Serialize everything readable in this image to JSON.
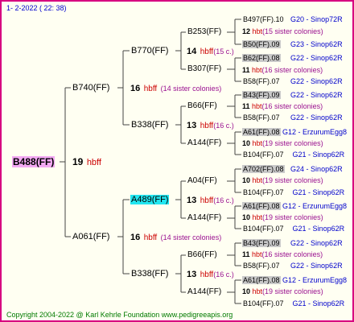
{
  "header": {
    "text": "1-  2-2022 ( 22: 38)"
  },
  "root": {
    "name": "B488(FF)",
    "num": "19",
    "hb": "hbff"
  },
  "gen1": [
    {
      "name": "B740(FF)",
      "num": "16",
      "hb": "hbff",
      "sis": "(14 sister colonies)"
    },
    {
      "name": "A061(FF)",
      "num": "16",
      "hb": "hbff",
      "sis": "(14 sister colonies)"
    }
  ],
  "gen2": [
    {
      "name": "B770(FF)",
      "num": "14",
      "hb": "hbff",
      "sis": "(15 c.)"
    },
    {
      "name": "B338(FF)",
      "num": "13",
      "hb": "hbff",
      "sis": "(16 c.)"
    },
    {
      "name": "A489(FF)",
      "num": "13",
      "hb": "hbff",
      "sis": "(16 c.)"
    },
    {
      "name": "B338(FF)",
      "num": "13",
      "hb": "hbff",
      "sis": "(16 c.)"
    }
  ],
  "gen3": [
    {
      "name": "B253(FF)",
      "num": "14",
      "hb": "hbff",
      "sis": "(15 c.)"
    },
    {
      "name": "B307(FF)"
    },
    {
      "name": "B66(FF)",
      "num": "13",
      "hb": "hbff",
      "sis": "(16 c.)"
    },
    {
      "name": "A144(FF)"
    },
    {
      "name": "A04(FF)",
      "num": "13",
      "hb": "hbff",
      "sis": "(16 c.)"
    },
    {
      "name": "A144(FF)"
    },
    {
      "name": "B66(FF)",
      "num": "13",
      "hb": "hbff",
      "sis": "(16 c.)"
    },
    {
      "name": "A144(FF)"
    }
  ],
  "gen4": [
    {
      "name": "B497(FF).10",
      "cls": "G20 - Sinop72R",
      "num": "12",
      "hb": "hbt",
      "sis": "(15 sister colonies)"
    },
    {
      "name": "B50(FF).09",
      "cls": "G23 - Sinop62R",
      "num": "",
      "hb": "",
      "sis": ""
    },
    {
      "name": "B62(FF).08",
      "cls": "G22 - Sinop62R",
      "num": "11",
      "hb": "hbt",
      "sis": "(16 sister colonies)"
    },
    {
      "name": "B58(FF).07",
      "cls": "G22 - Sinop62R",
      "num": "",
      "hb": "",
      "sis": ""
    },
    {
      "name": "B43(FF).09",
      "cls": "G22 - Sinop62R",
      "num": "11",
      "hb": "hbt",
      "sis": "(16 sister colonies)"
    },
    {
      "name": "B58(FF).07",
      "cls": "G22 - Sinop62R",
      "num": "",
      "hb": "",
      "sis": ""
    },
    {
      "name": "A61(FF).08",
      "cls": "G12 - ErzurumEgg8",
      "num": "10",
      "hb": "hbt",
      "sis": "(19 sister colonies)"
    },
    {
      "name": "B104(FF).07",
      "cls": "G21 - Sinop62R",
      "num": "",
      "hb": "",
      "sis": ""
    },
    {
      "name": "A702(FF).08",
      "cls": "G24 - Sinop62R",
      "num": "10",
      "hb": "hbt",
      "sis": "(19 sister colonies)"
    },
    {
      "name": "B104(FF).07",
      "cls": "G21 - Sinop62R",
      "num": "",
      "hb": "",
      "sis": ""
    },
    {
      "name": "A61(FF).08",
      "cls": "G12 - ErzurumEgg8",
      "num": "10",
      "hb": "hbt",
      "sis": "(19 sister colonies)"
    },
    {
      "name": "B104(FF).07",
      "cls": "G21 - Sinop62R",
      "num": "",
      "hb": "",
      "sis": ""
    },
    {
      "name": "B43(FF).09",
      "cls": "G22 - Sinop62R",
      "num": "11",
      "hb": "hbt",
      "sis": "(16 sister colonies)"
    },
    {
      "name": "B58(FF).07",
      "cls": "G22 - Sinop62R",
      "num": "",
      "hb": "",
      "sis": ""
    },
    {
      "name": "A61(FF).08",
      "cls": "G12 - ErzurumEgg8",
      "num": "10",
      "hb": "hbt",
      "sis": "(19 sister colonies)"
    },
    {
      "name": "B104(FF).07",
      "cls": "G21 - Sinop62R",
      "num": "",
      "hb": "",
      "sis": ""
    }
  ],
  "footer": {
    "text": "Copyright 2004-2022 @ Karl Kehrle Foundation    www.pedigreeapis.org"
  },
  "colors": {
    "frame_border": "#d70080",
    "root_highlight": "#f3a9f3",
    "selected_highlight": "#22e6f0",
    "shaded_name": "#c9c9c9",
    "hb_red": "#cc0000",
    "class_blue": "#0000cc",
    "footer_green": "#007a00"
  }
}
